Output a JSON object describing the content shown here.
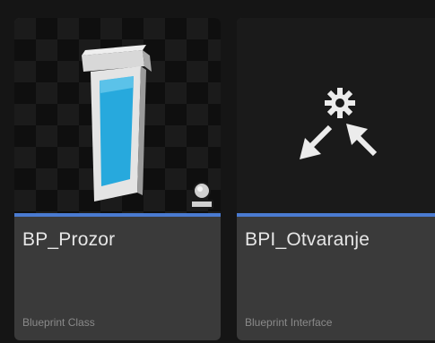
{
  "assets": [
    {
      "name": "BP_Prozor",
      "type": "Blueprint Class",
      "thumbnail_icon": "window-mesh-icon",
      "badge_icon": "actor-icon",
      "stripe_color": "#4a7bd1"
    },
    {
      "name": "BPI_Otvaranje",
      "type": "Blueprint Interface",
      "thumbnail_icon": "interface-icon",
      "stripe_color": "#4a7bd1"
    }
  ]
}
